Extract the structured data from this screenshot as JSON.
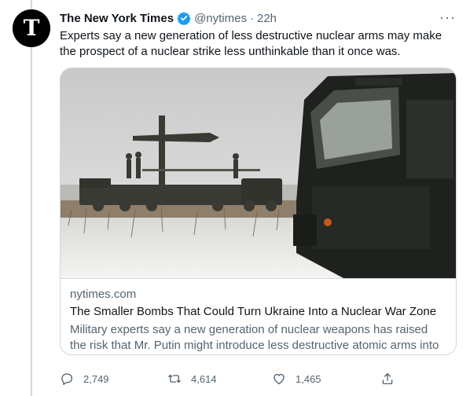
{
  "tweet": {
    "author_name": "The New York Times",
    "handle": "@nytimes",
    "separator": "·",
    "time": "22h",
    "more": "···",
    "text": "Experts say a new generation of less destructive nuclear arms may make the prospect of a nuclear strike less unthinkable than it once was."
  },
  "card": {
    "domain": "nytimes.com",
    "title": "The Smaller Bombs That Could Turn Ukraine Into a Nuclear War Zone",
    "description": "Military experts say a new generation of nuclear weapons has raised the risk that Mr. Putin might introduce less destructive atomic arms into the..."
  },
  "actions": {
    "replies": "2,749",
    "retweets": "4,614",
    "likes": "1,465"
  },
  "colors": {
    "verified": "#1d9bf0",
    "text_primary": "#0f1419",
    "text_secondary": "#536471",
    "border": "#cfd9de"
  },
  "icons": [
    "nyt-logo-icon",
    "verified-badge-icon",
    "more-icon",
    "reply-icon",
    "retweet-icon",
    "like-icon",
    "share-icon"
  ]
}
